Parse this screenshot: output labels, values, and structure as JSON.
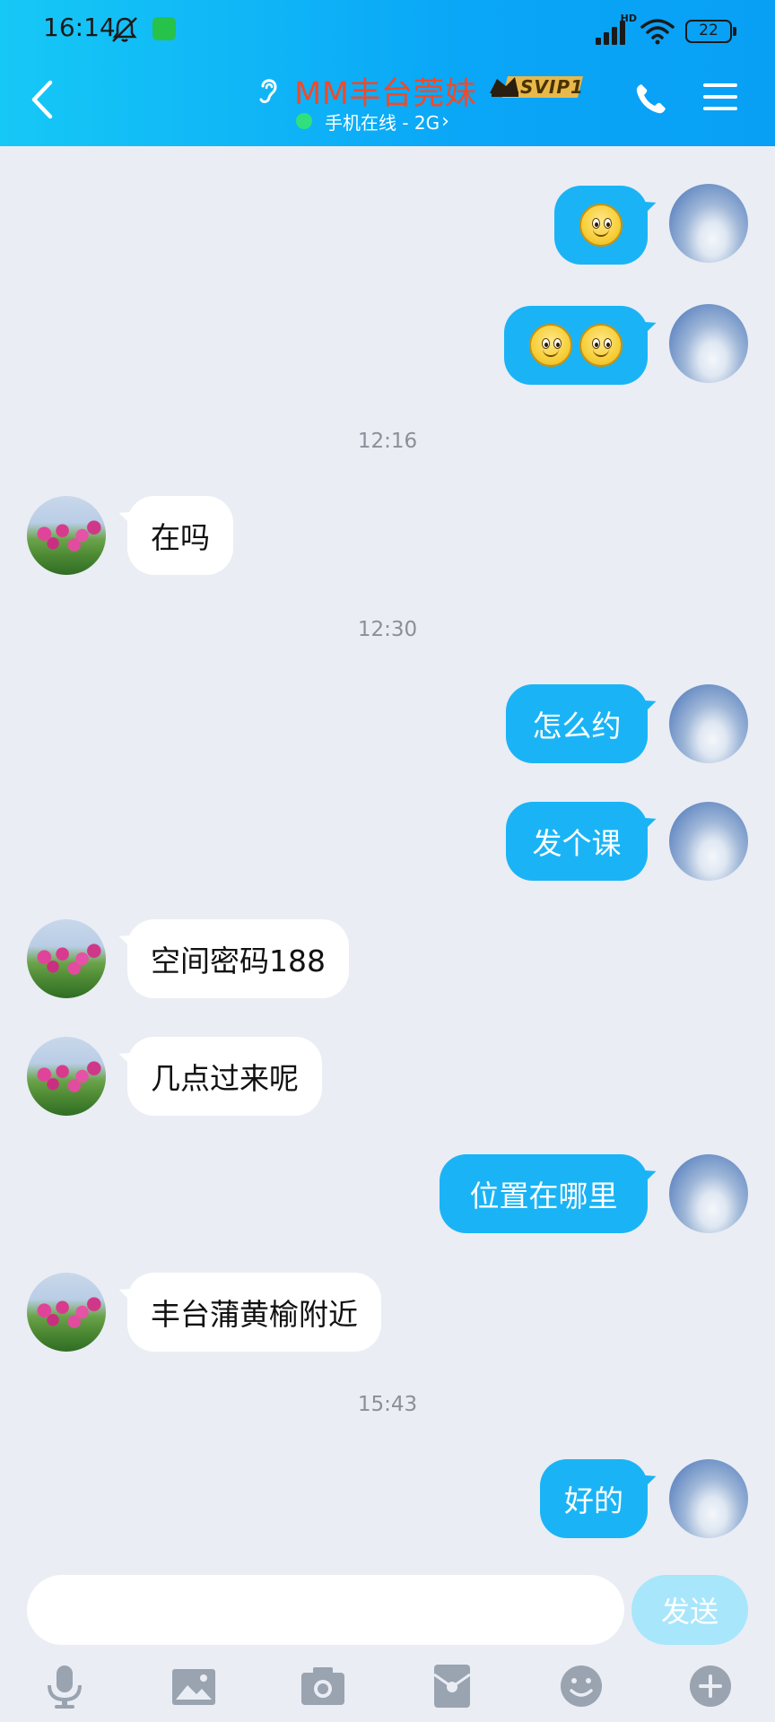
{
  "status_bar": {
    "time": "16:14",
    "network_label": "HD",
    "battery": "22"
  },
  "header": {
    "title": "MM丰台莞妹",
    "badge": "SVIP1",
    "presence_text": "手机在线 - 2G",
    "presence_chevron": "›",
    "colors": {
      "title": "#f04a2a",
      "header_start": "#16c8f6",
      "header_end": "#08a0f5",
      "online_dot": "#2fe07c"
    },
    "icons": [
      "back-icon",
      "ear-icon",
      "svip-crown-icon",
      "phone-icon",
      "menu-icon"
    ]
  },
  "messages": [
    {
      "kind": "emoji",
      "side": "out",
      "emoji_count": 1
    },
    {
      "kind": "emoji",
      "side": "out",
      "emoji_count": 2
    },
    {
      "kind": "time",
      "text": "12:16"
    },
    {
      "kind": "text",
      "side": "in",
      "text": "在吗"
    },
    {
      "kind": "time",
      "text": "12:30"
    },
    {
      "kind": "text",
      "side": "out",
      "text": "怎么约"
    },
    {
      "kind": "text",
      "side": "out",
      "text": "发个课"
    },
    {
      "kind": "text",
      "side": "in",
      "text": "空间密码188"
    },
    {
      "kind": "text",
      "side": "in",
      "text": "几点过来呢"
    },
    {
      "kind": "text",
      "side": "out",
      "text": "位置在哪里"
    },
    {
      "kind": "text",
      "side": "in",
      "text": "丰台蒲黄榆附近"
    },
    {
      "kind": "time",
      "text": "15:43"
    },
    {
      "kind": "text",
      "side": "out",
      "text": "好的"
    }
  ],
  "composer": {
    "input_value": "",
    "send_label": "发送",
    "toolbar_icons": [
      "microphone-icon",
      "image-icon",
      "camera-icon",
      "red-packet-icon",
      "emoji-icon",
      "plus-icon"
    ]
  },
  "colors": {
    "outgoing_bubble": "#1ab4f6",
    "incoming_bubble": "#ffffff",
    "chat_background": "#eaedf4",
    "send_button_disabled": "#a8e6fb"
  }
}
